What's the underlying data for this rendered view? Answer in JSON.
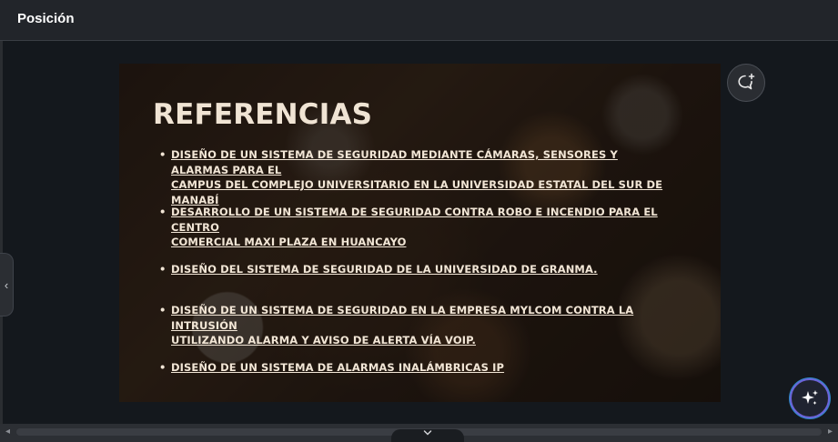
{
  "header": {
    "title": "Posición"
  },
  "slide": {
    "heading": "REFERENCIAS",
    "references": [
      {
        "line1": "DISEÑO DE UN SISTEMA DE SEGURIDAD MEDIANTE CÁMARAS, SENSORES Y ALARMAS PARA EL",
        "line2": "CAMPUS DEL COMPLEJO UNIVERSITARIO EN LA UNIVERSIDAD ESTATAL DEL SUR DE MANABÍ"
      },
      {
        "line1": "DESARROLLO DE UN SISTEMA DE SEGURIDAD CONTRA ROBO E INCENDIO PARA EL CENTRO",
        "line2": "COMERCIAL MAXI PLAZA EN HUANCAYO"
      },
      {
        "line1": "DISEÑO DEL SISTEMA DE SEGURIDAD DE LA UNIVERSIDAD DE GRANMA.",
        "line2": ""
      },
      {
        "line1": "DISEÑO DE UN SISTEMA DE SEGURIDAD EN LA EMPRESA MYLCOM CONTRA LA INTRUSIÓN",
        "line2": "UTILIZANDO ALARMA Y AVISO DE ALERTA VÍA VOIP."
      },
      {
        "line1": "DISEÑO DE UN SISTEMA DE ALARMAS INALÁMBRICAS IP",
        "line2": ""
      }
    ]
  },
  "icons": {
    "comment": "add-comment-icon",
    "ai": "sparkles-icon",
    "left_handle": "chevron-left-icon",
    "bottom_tab": "chevron-down-icon",
    "scroll_left": "arrow-left-icon",
    "scroll_right": "arrow-right-icon"
  },
  "glyphs": {
    "chevron_left": "‹",
    "scroll_left": "◂",
    "scroll_right": "▸"
  },
  "colors": {
    "background": "#14181d",
    "topbar": "#22252a",
    "slide_text": "#f2e6d6",
    "ai_ring": "#6c63d9"
  }
}
